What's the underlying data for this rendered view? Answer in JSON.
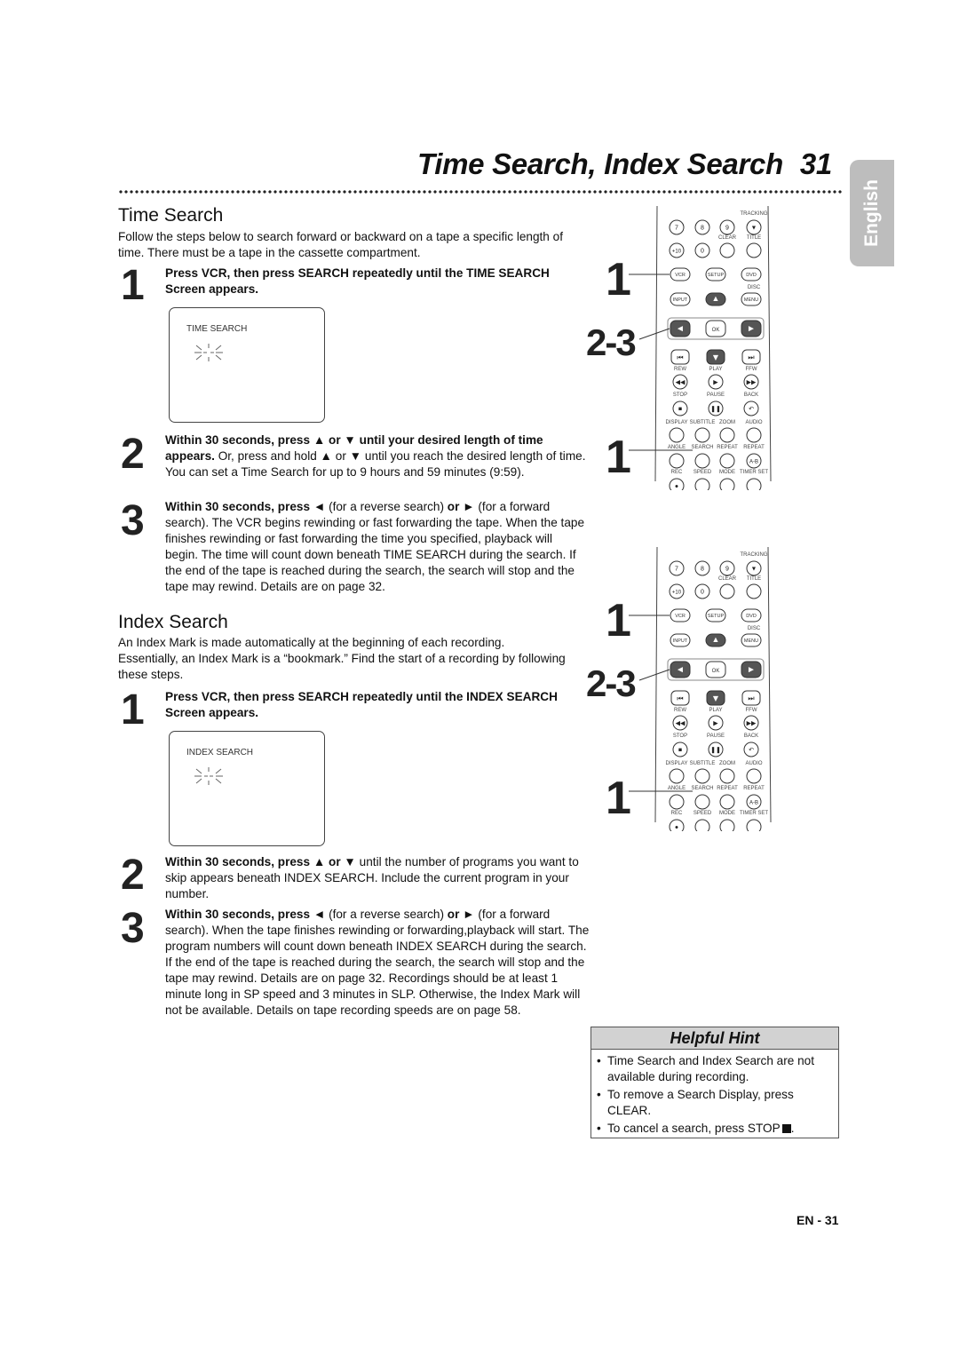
{
  "header": {
    "title": "Time Search, Index Search",
    "page_number": "31",
    "language_tab": "English"
  },
  "time_search": {
    "heading": "Time Search",
    "intro": "Follow the steps below to search forward or backward on a tape a specific length of time. There must be a tape in the cassette compartment.",
    "steps": [
      {
        "num": "1",
        "bold": "Press VCR, then press SEARCH repeatedly until the TIME SEARCH Screen appears.",
        "text": ""
      },
      {
        "num": "2",
        "bold": "Within 30 seconds, press ▲ or ▼ until your desired length of time appears.",
        "text": " Or, press and hold ▲ or ▼ until you reach the desired length of time. You can set a Time Search for up to 9 hours and 59 minutes (9:59)."
      },
      {
        "num": "3",
        "bold_parts": [
          "Within 30 seconds, press ◄",
          " (for a reverse search) ",
          "or ►",
          " (for a forward search). The VCR begins rewinding or fast forwarding the tape. When the tape finishes rewinding or fast forwarding the time you specified, playback will begin. The time will count down beneath TIME SEARCH during the search. If the end of the tape is reached during the search, the search will stop and the tape may rewind. Details are on page 32."
        ]
      }
    ],
    "screen_label": "TIME SEARCH",
    "screen_value": "-:--"
  },
  "index_search": {
    "heading": "Index Search",
    "intro": "An Index Mark is made automatically at the beginning of each recording. Essentially, an Index Mark is a “bookmark.” Find the start of a recording by following these steps.",
    "steps": [
      {
        "num": "1",
        "bold": "Press VCR, then press SEARCH repeatedly until the INDEX SEARCH Screen appears.",
        "text": ""
      },
      {
        "num": "2",
        "bold": "Within 30 seconds, press ▲ or ▼",
        "text": " until the number of programs you want to skip appears beneath INDEX SEARCH. Include the current program in your number."
      },
      {
        "num": "3",
        "bold_parts": [
          "Within 30 seconds, press ◄",
          " (for a reverse search) ",
          "or ►",
          " (for a forward search). When the tape finishes rewinding or forwarding,playback will start. The program numbers will count down beneath INDEX SEARCH during the search. If the end of the tape is reached during the search, the search will stop and the tape may rewind. Details are on page 32. Recordings should be at least 1 minute long in SP speed and 3 minutes in SLP. Otherwise, the Index Mark will not be available. Details on tape recording speeds are on page 58."
        ]
      }
    ],
    "screen_label": "INDEX SEARCH",
    "screen_value": "--"
  },
  "remote": {
    "step_labels": [
      "1",
      "2-3",
      "1"
    ],
    "rows": [
      {
        "type": "labels",
        "items": [
          "",
          "",
          "",
          "TRACKING"
        ]
      },
      {
        "type": "round",
        "items": [
          "7",
          "8",
          "9",
          "▼"
        ]
      },
      {
        "type": "labels",
        "items": [
          "",
          "",
          "CLEAR",
          "TITLE"
        ]
      },
      {
        "type": "round",
        "items": [
          "+10",
          "0",
          "",
          ""
        ]
      },
      {
        "type": "oval",
        "items": [
          "VCR",
          "SETUP",
          "DVD"
        ]
      },
      {
        "type": "labels",
        "items": [
          "",
          "",
          "",
          "DISC"
        ]
      },
      {
        "type": "oval",
        "items": [
          "INPUT",
          "▲",
          "MENU"
        ]
      },
      {
        "type": "nav",
        "items": [
          "◄",
          "OK",
          "►"
        ]
      },
      {
        "type": "nav2",
        "items": [
          "⏮",
          "▼",
          "⏭"
        ]
      },
      {
        "type": "labels",
        "items": [
          "REW",
          "PLAY",
          "FFW"
        ]
      },
      {
        "type": "round",
        "items": [
          "◀◀",
          "▶",
          "▶▶"
        ]
      },
      {
        "type": "labels",
        "items": [
          "STOP",
          "PAUSE",
          "BACK"
        ]
      },
      {
        "type": "round",
        "items": [
          "■",
          "❚❚",
          "↶"
        ]
      },
      {
        "type": "labels",
        "items": [
          "DISPLAY",
          "SUBTITLE",
          "ZOOM",
          "AUDIO"
        ]
      },
      {
        "type": "round",
        "items": [
          "",
          "",
          "",
          ""
        ]
      },
      {
        "type": "labels",
        "items": [
          "ANGLE",
          "SEARCH",
          "REPEAT",
          "REPEAT"
        ]
      },
      {
        "type": "round",
        "items": [
          "",
          "",
          "",
          "A-B"
        ]
      },
      {
        "type": "labels",
        "items": [
          "REC",
          "SPEED",
          "MODE",
          "TIMER SET"
        ]
      },
      {
        "type": "round",
        "items": [
          "●",
          "",
          "",
          ""
        ]
      }
    ]
  },
  "helpful_hint": {
    "title": "Helpful Hint",
    "items": [
      "Time Search and Index Search are not available during recording.",
      "To remove a Search Display, press CLEAR.",
      "To cancel a search, press STOP"
    ]
  },
  "footer": {
    "page_label": "EN - 31"
  }
}
